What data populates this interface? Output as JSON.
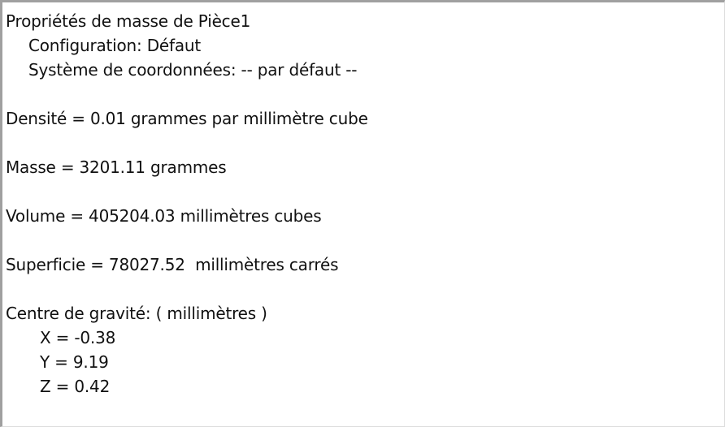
{
  "title": "Propriétés de masse de Pièce1",
  "configuration": "Configuration: Défaut",
  "coordinate_system": "Système de coordonnées: -- par défaut --",
  "density": "Densité = 0.01 grammes par millimètre cube",
  "mass": "Masse = 3201.11 grammes",
  "volume": "Volume = 405204.03 millimètres cubes",
  "surface": "Superficie = 78027.52  millimètres carrés",
  "center_of_gravity": {
    "heading": "Centre de gravité: ( millimètres )",
    "x": "X = -0.38",
    "y": "Y = 9.19",
    "z": "Z = 0.42"
  }
}
